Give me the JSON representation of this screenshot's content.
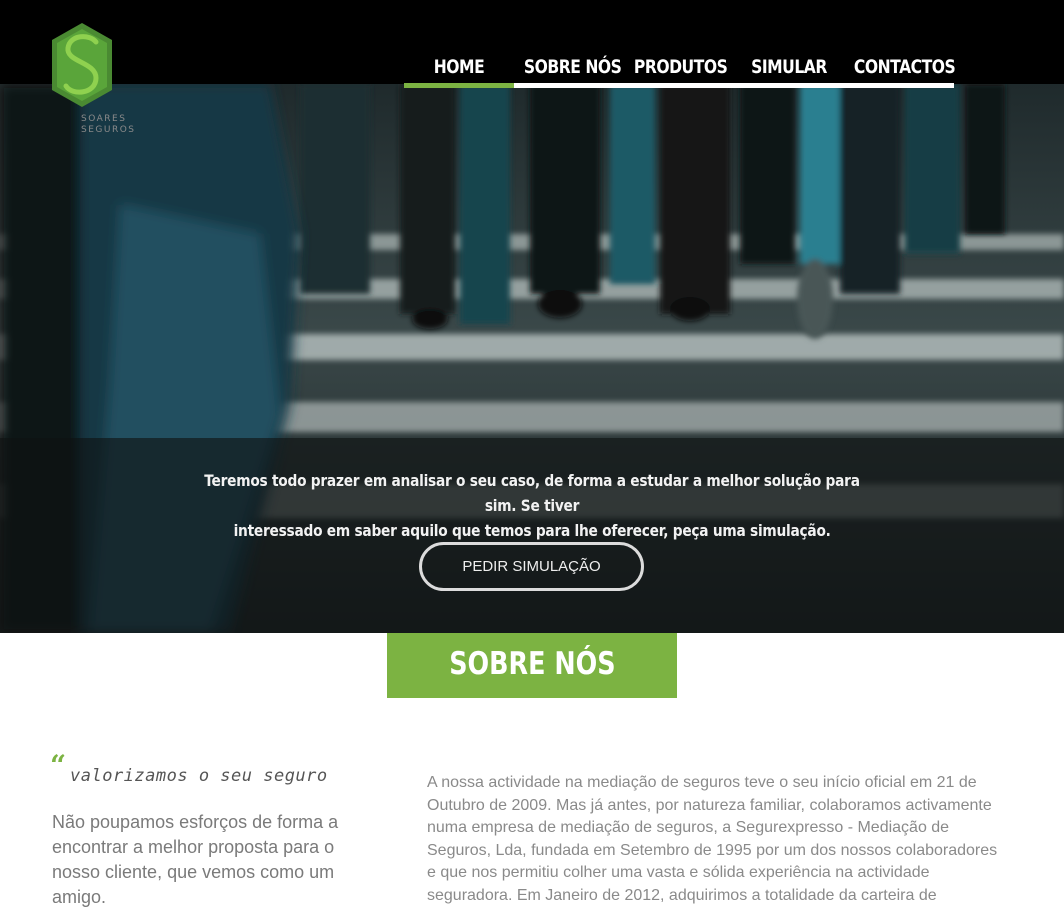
{
  "brand": {
    "logo_letter": "S",
    "name_line1": "SOARES",
    "name_line2": "SEGUROS",
    "logo_color": "#7cb342"
  },
  "nav": {
    "items": [
      {
        "label": "HOME",
        "active": true
      },
      {
        "label": "SOBRE NÓS",
        "active": false
      },
      {
        "label": "PRODUTOS",
        "active": false
      },
      {
        "label": "SIMULAR",
        "active": false
      },
      {
        "label": "CONTACTOS",
        "active": false
      }
    ],
    "active_color": "#7cb342",
    "bar_color": "#ffffff"
  },
  "hero": {
    "line1": "Teremos todo prazer em analisar o seu caso, de forma a estudar a melhor solução para sim. Se tiver",
    "line2": "interessado em saber aquilo que temos para lhe oferecer, peça uma simulação.",
    "button_label": "PEDIR SIMULAÇÃO"
  },
  "about": {
    "title": "SOBRE NÓS",
    "quote_mark": "“",
    "quote": "valorizamos o seu seguro",
    "left_lines": [
      "Não poupamos esforços de forma a",
      "encontrar a melhor proposta para o",
      "nosso cliente, que vemos como um",
      "amigo."
    ],
    "right_lines": [
      "A nossa actividade na mediação de seguros teve o seu início oficial em 21 de",
      "Outubro de 2009. Mas já antes, por natureza familiar, colaboramos activamente",
      "numa empresa de mediação de seguros, a Segurexpresso - Mediação de",
      "Seguros, Lda, fundada em Setembro de 1995 por um dos nossos colaboradores",
      "e que nos permitiu colher uma vasta e sólida experiência na actividade",
      "seguradora. Em Janeiro de 2012, adquirimos a totalidade da carteira de"
    ],
    "accent_color": "#7cb342"
  }
}
